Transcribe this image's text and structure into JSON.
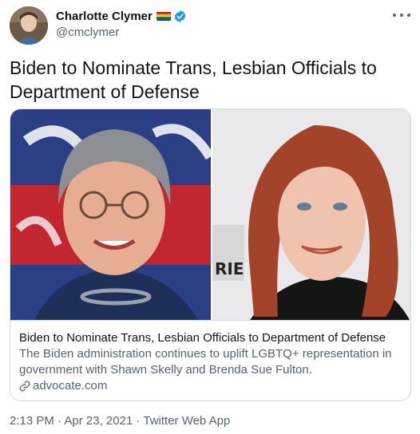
{
  "author": {
    "display_name": "Charlotte Clymer",
    "handle": "@cmclymer",
    "flag_icon": "rainbow-flag",
    "verified_icon": "verified-badge",
    "verified_color": "#1d9bf0"
  },
  "more_icon": "more-horizontal",
  "tweet": {
    "text": "Biden to Nominate Trans, Lesbian Officials to Department of Defense"
  },
  "card": {
    "title": "Biden to Nominate Trans, Lesbian Officials to Department of Defense",
    "description": "The Biden administration continues to uplift LGBTQ+ representation in government with Shawn Skelly and Brenda Sue Fulton.",
    "domain": "advocate.com",
    "link_icon": "link"
  },
  "timestamp": {
    "time": "2:13 PM",
    "separator": " · ",
    "date": "Apr 23, 2021",
    "app": "Twitter Web App"
  },
  "colors": {
    "text_primary": "#0f1419",
    "text_secondary": "#536471",
    "border": "#cfd9de"
  }
}
